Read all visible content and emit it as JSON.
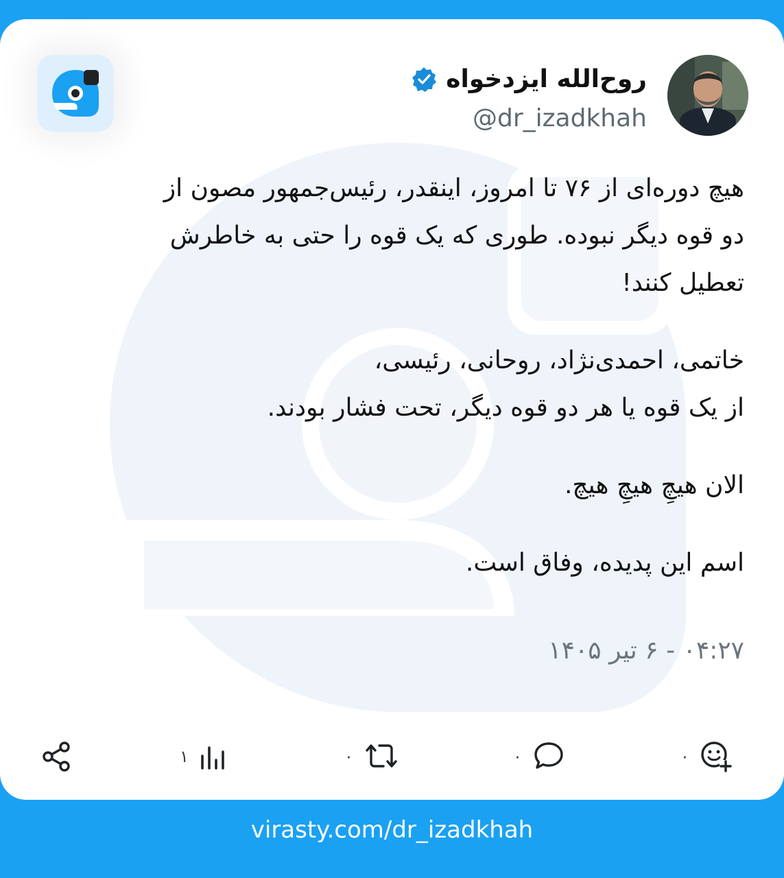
{
  "author": {
    "display_name": "روح‌الله ایزدخواه",
    "handle": "@dr_izadkhah",
    "verified": true
  },
  "post": {
    "paragraphs": [
      [
        "هیچ دوره‌ای از ۷۶ تا امروز، اینقدر، رئیس‌جمهور مصون از",
        "دو قوه دیگر نبوده. طوری که یک قوه را حتی به خاطرش",
        "تعطیل کنند!"
      ],
      [
        "خاتمی، احمدی‌نژاد، روحانی، رئیسی،",
        "از یک قوه یا هر دو قوه دیگر، تحت فشار بودند."
      ],
      [
        "الان هیچِ هیچِ هیچ."
      ],
      [
        "اسم این پدیده، وفاق است."
      ]
    ],
    "timestamp": "۰۴:۲۷ - ۶ تیر ۱۴۰۵"
  },
  "actions": {
    "reactions_count": "۰",
    "comments_count": "۰",
    "reposts_count": "۰",
    "views_count": "۱"
  },
  "footer": {
    "url": "virasty.com/dr_izadkhah"
  },
  "colors": {
    "brand": "#1aa1f2",
    "verified": "#1a8cd8",
    "text": "#111111",
    "muted": "#6b757c"
  },
  "icons": [
    "verified-badge-icon",
    "virasty-logo-icon",
    "add-reaction-icon",
    "comment-icon",
    "repost-icon",
    "views-icon",
    "share-icon"
  ]
}
